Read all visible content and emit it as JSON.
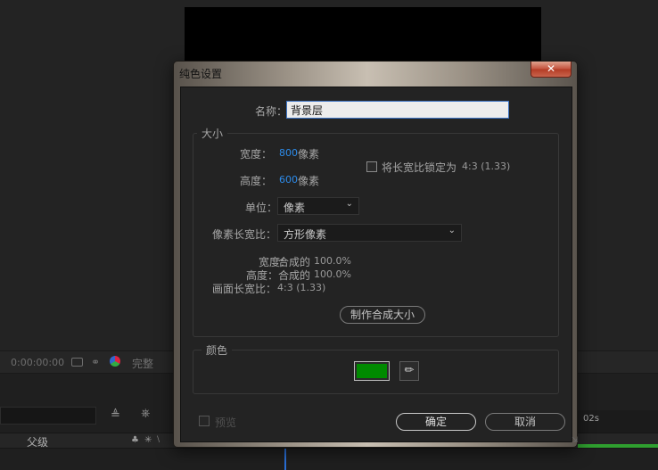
{
  "background": {
    "timecode": "0:00:00:00",
    "quality_label": "完整",
    "timeline_parent_header": "父级",
    "timeline_ruler_label": "02s"
  },
  "dialog": {
    "title": "纯色设置",
    "close_glyph": "✕",
    "name_label": "名称：",
    "name_value": "背景层",
    "size": {
      "group_title": "大小",
      "width_label": "宽度：",
      "width_value": "800",
      "width_unit": "像素",
      "height_label": "高度：",
      "height_value": "600",
      "height_unit": "像素",
      "lock_label": "将长宽比锁定为",
      "lock_ratio": "4:3 (1.33)",
      "lock_checked": false,
      "units_label": "单位：",
      "units_value": "像素",
      "pixel_aspect_label": "像素长宽比：",
      "pixel_aspect_value": "方形像素",
      "info_width_label": "宽度：",
      "info_width_text": "合成的",
      "info_width_value": "100.0%",
      "info_height_label": "高度：",
      "info_height_text": "合成的",
      "info_height_value": "100.0%",
      "frame_aspect_label": "画面长宽比：",
      "frame_aspect_value": "4:3 (1.33)",
      "make_comp_size_button": "制作合成大小"
    },
    "color": {
      "group_title": "颜色",
      "swatch_color": "#008a00"
    },
    "preview_label": "预览",
    "preview_checked": false,
    "ok_button": "确定",
    "cancel_button": "取消"
  }
}
